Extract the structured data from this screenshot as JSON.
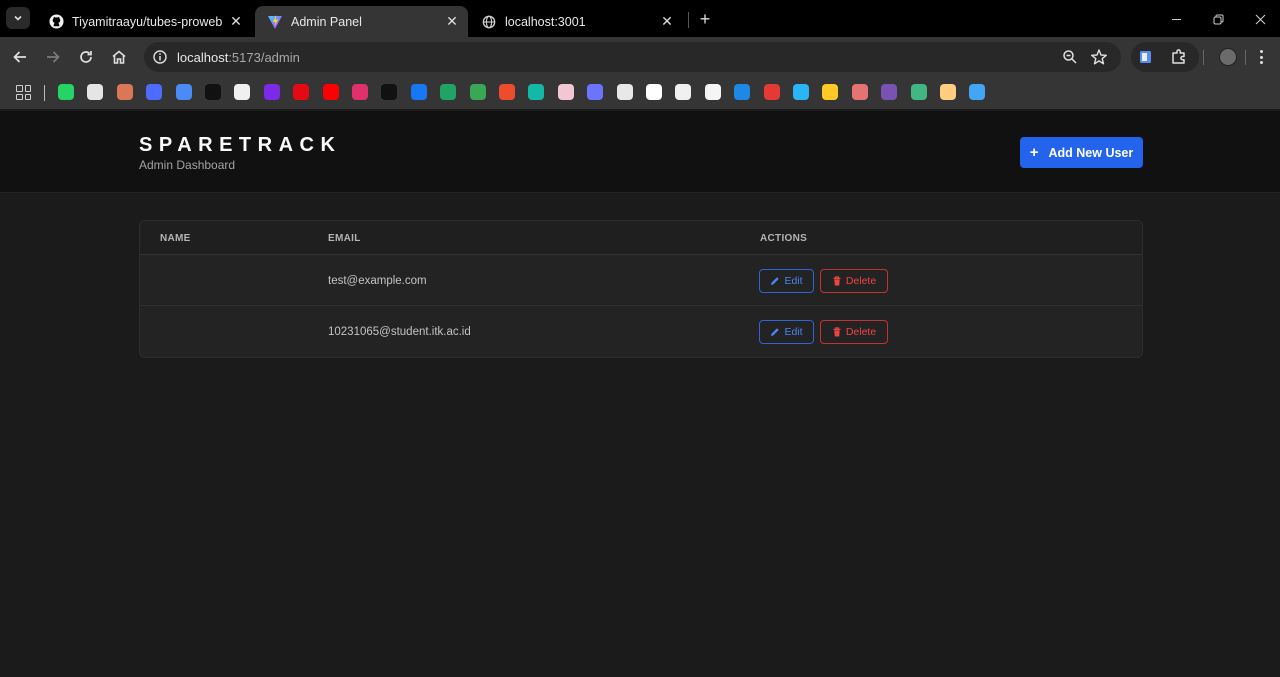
{
  "browser": {
    "tabs": [
      {
        "title": "Tiyamitraayu/tubes-proweb",
        "icon": "github-icon",
        "active": false
      },
      {
        "title": "Admin Panel",
        "icon": "vite-icon",
        "active": true
      },
      {
        "title": "localhost:3001",
        "icon": "globe-icon",
        "active": false
      }
    ],
    "address": {
      "host": "localhost",
      "path": ":5173/admin"
    },
    "bookmarks": [
      {
        "name": "whatsapp",
        "color": "#25d366"
      },
      {
        "name": "openai",
        "color": "#e5e5e5"
      },
      {
        "name": "claude",
        "color": "#d97757"
      },
      {
        "name": "deepseek",
        "color": "#4d6bfe"
      },
      {
        "name": "gemini",
        "color": "#4b8bf5"
      },
      {
        "name": "perplexity",
        "color": "#111111"
      },
      {
        "name": "notion",
        "color": "#f0f0f0"
      },
      {
        "name": "canva",
        "color": "#7d2ae8"
      },
      {
        "name": "netflix",
        "color": "#e50914"
      },
      {
        "name": "youtube",
        "color": "#ff0000"
      },
      {
        "name": "instagram",
        "color": "#e1306c"
      },
      {
        "name": "tiktok",
        "color": "#111111"
      },
      {
        "name": "facebook",
        "color": "#1877f2"
      },
      {
        "name": "google-drive",
        "color": "#1fa463"
      },
      {
        "name": "app-green",
        "color": "#3aa757"
      },
      {
        "name": "shopee",
        "color": "#ee4d2d"
      },
      {
        "name": "app-teal",
        "color": "#14b8a6"
      },
      {
        "name": "app-photo",
        "color": "#f3c6d3"
      },
      {
        "name": "app-ring",
        "color": "#6b73ff"
      },
      {
        "name": "app-doc",
        "color": "#e8e8e8"
      },
      {
        "name": "app-chart",
        "color": "#ffffff"
      },
      {
        "name": "github",
        "color": "#f0f0f0"
      },
      {
        "name": "app-box",
        "color": "#f5f5f5"
      },
      {
        "name": "itk",
        "color": "#1e88e5"
      },
      {
        "name": "app-heart",
        "color": "#e53935"
      },
      {
        "name": "app-robot",
        "color": "#29b6f6"
      },
      {
        "name": "app-image",
        "color": "#ffca28"
      },
      {
        "name": "app-donut",
        "color": "#e57373"
      },
      {
        "name": "bootstrap",
        "color": "#7952b3"
      },
      {
        "name": "vue",
        "color": "#41b883"
      },
      {
        "name": "app-person",
        "color": "#ffcc80"
      },
      {
        "name": "app-flutter",
        "color": "#42a5f5"
      }
    ]
  },
  "header": {
    "brand": "SPARETRACK",
    "subtitle": "Admin Dashboard",
    "add_button": "Add New User",
    "accent": "#2463eb"
  },
  "table": {
    "columns": [
      "NAME",
      "EMAIL",
      "ACTIONS"
    ],
    "rows": [
      {
        "name": "",
        "email": "test@example.com"
      },
      {
        "name": "",
        "email": "10231065@student.itk.ac.id"
      }
    ],
    "edit_label": "Edit",
    "delete_label": "Delete"
  }
}
